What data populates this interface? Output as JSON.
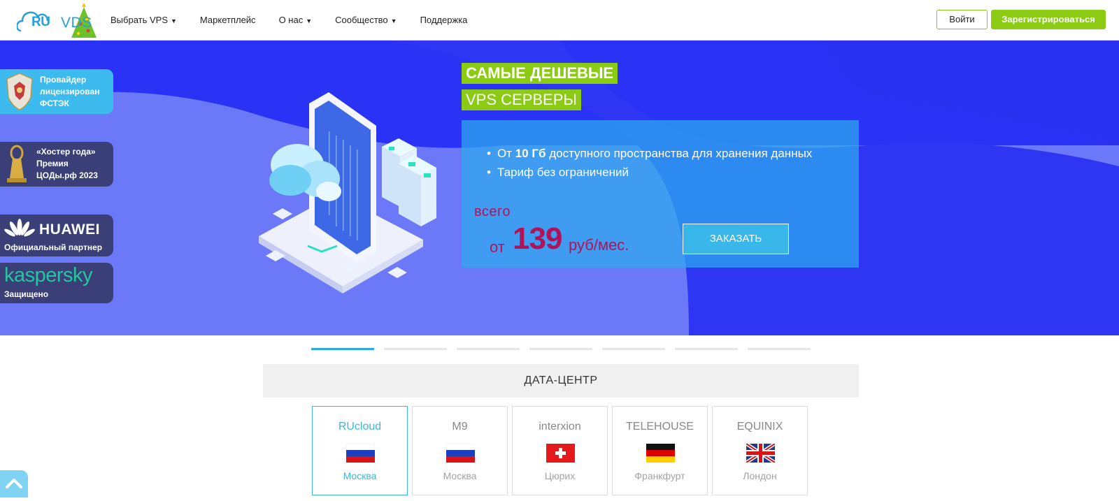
{
  "brand": {
    "ru": "RU",
    "vds": "VDS"
  },
  "nav": [
    {
      "label": "Выбрать VPS",
      "has_dropdown": true
    },
    {
      "label": "Маркетплейс",
      "has_dropdown": false
    },
    {
      "label": "О нас",
      "has_dropdown": true
    },
    {
      "label": "Сообщество",
      "has_dropdown": true
    },
    {
      "label": "Поддержка",
      "has_dropdown": false
    }
  ],
  "auth": {
    "login": "Войти",
    "register": "Зарегистрироваться"
  },
  "badges": {
    "fstek": "Провайдер\nлицензирован\nФСТЭК",
    "hoster": "«Хостер года»\nПремия\nЦОДы.рф 2023",
    "huawei_word": "HUAWEI",
    "huawei_sub": "Официальный партнер",
    "kasper_word": "kaspersky",
    "kasper_sub": "Защищено"
  },
  "hero": {
    "headline_1": "САМЫЕ ДЕШЕВЫЕ",
    "headline_2": "VPS СЕРВЕРЫ",
    "feature_1_pre": "От ",
    "feature_1_bold": "10 Гб",
    "feature_1_post": " доступного пространства для хранения данных",
    "feature_2": "Тариф без ограничений",
    "price_label": "всего",
    "price_from": "от",
    "price_value": "139",
    "price_unit": "руб/мес.",
    "order_button": "ЗАКАЗАТЬ"
  },
  "slider": {
    "count": 7,
    "active_index": 0
  },
  "datacenter": {
    "title": "ДАТА-ЦЕНТР",
    "cards": [
      {
        "logo": "RUcloud",
        "city": "Москва",
        "flag": "ru",
        "active": true
      },
      {
        "logo": "M9",
        "city": "Москва",
        "flag": "ru",
        "active": false
      },
      {
        "logo": "interxion",
        "city": "Цюрих",
        "flag": "ch",
        "active": false
      },
      {
        "logo": "TELEHOUSE",
        "city": "Франкфурт",
        "flag": "de",
        "active": false
      },
      {
        "logo": "EQUINIX",
        "city": "Лондон",
        "flag": "gb",
        "active": false
      }
    ]
  },
  "colors": {
    "accent_green": "#8ccb14",
    "accent_blue": "#2aa8e0",
    "price": "#b0135a",
    "hero_bg": "#2a33f5"
  },
  "icons": [
    "christmas-tree-icon",
    "fstek-emblem-icon",
    "award-statue-icon",
    "huawei-petal-icon",
    "scroll-up-icon"
  ]
}
